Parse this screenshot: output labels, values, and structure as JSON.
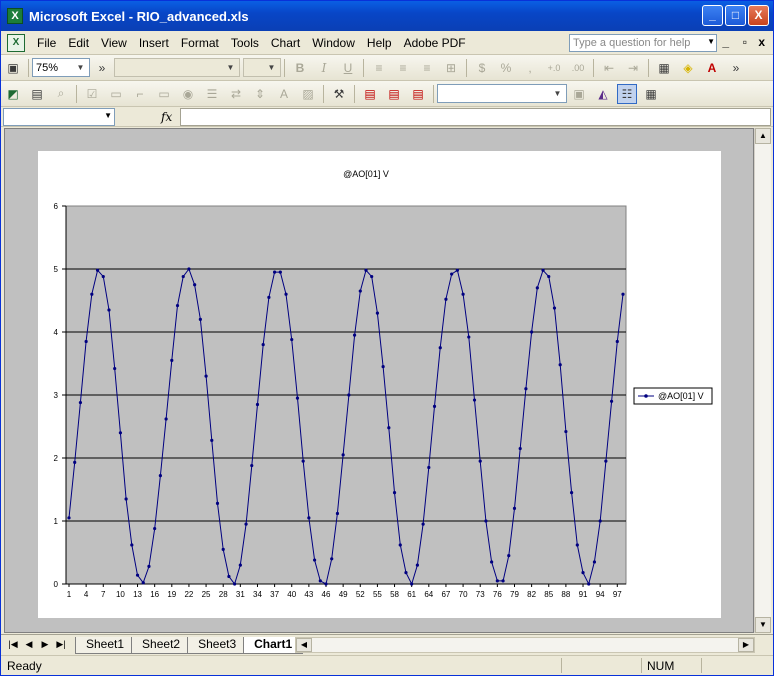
{
  "window": {
    "title": "Microsoft Excel - RIO_advanced.xls",
    "app_icon": "excel-icon",
    "minimize": "_",
    "maximize": "□",
    "close": "X"
  },
  "menu": {
    "items": [
      "File",
      "Edit",
      "View",
      "Insert",
      "Format",
      "Tools",
      "Chart",
      "Window",
      "Help",
      "Adobe PDF"
    ],
    "ask_placeholder": "Type a question for help",
    "restore": "▫",
    "close": "x"
  },
  "toolbar1": {
    "zoom": "75%",
    "bold": "B",
    "italic": "I",
    "underline": "U",
    "currency": "$",
    "percent": "%",
    "comma": ",",
    "more": "»"
  },
  "toolbar2": {
    "more": "»"
  },
  "formula": {
    "fx_label": "fx",
    "value": ""
  },
  "sheet_tabs": {
    "tabs": [
      "Sheet1",
      "Sheet2",
      "Sheet3",
      "Chart1"
    ],
    "active": "Chart1"
  },
  "status": {
    "ready": "Ready",
    "num": "NUM"
  },
  "chart_data": {
    "type": "line",
    "title": "@AO[01] V",
    "legend": [
      "@AO[01] V"
    ],
    "legend_position": "right",
    "ylim": [
      0,
      6
    ],
    "yticks": [
      0,
      1,
      2,
      3,
      4,
      5,
      6
    ],
    "grid": true,
    "xticks": [
      1,
      4,
      7,
      10,
      13,
      16,
      19,
      22,
      25,
      28,
      31,
      34,
      37,
      40,
      43,
      46,
      49,
      52,
      55,
      58,
      61,
      64,
      67,
      70,
      73,
      76,
      79,
      82,
      85,
      88,
      91,
      94,
      97
    ],
    "series": [
      {
        "name": "@AO[01] V",
        "color": "#000080",
        "x": [
          1,
          2,
          3,
          4,
          5,
          6,
          7,
          8,
          9,
          10,
          11,
          12,
          13,
          14,
          15,
          16,
          17,
          18,
          19,
          20,
          21,
          22,
          23,
          24,
          25,
          26,
          27,
          28,
          29,
          30,
          31,
          32,
          33,
          34,
          35,
          36,
          37,
          38,
          39,
          40,
          41,
          42,
          43,
          44,
          45,
          46,
          47,
          48,
          49,
          50,
          51,
          52,
          53,
          54,
          55,
          56,
          57,
          58,
          59,
          60,
          61,
          62,
          63,
          64,
          65,
          66,
          67,
          68,
          69,
          70,
          71,
          72,
          73,
          74,
          75,
          76,
          77,
          78,
          79,
          80,
          81,
          82,
          83,
          84,
          85,
          86,
          87,
          88,
          89,
          90,
          91,
          92,
          93,
          94,
          95,
          96,
          97,
          98
        ],
        "values": [
          1.05,
          1.93,
          2.88,
          3.85,
          4.6,
          4.98,
          4.88,
          4.35,
          3.42,
          2.4,
          1.35,
          0.62,
          0.14,
          0.02,
          0.28,
          0.88,
          1.72,
          2.62,
          3.55,
          4.42,
          4.88,
          5.0,
          4.75,
          4.2,
          3.3,
          2.28,
          1.28,
          0.55,
          0.12,
          0.0,
          0.3,
          0.95,
          1.88,
          2.85,
          3.8,
          4.55,
          4.95,
          4.95,
          4.6,
          3.88,
          2.95,
          1.95,
          1.05,
          0.38,
          0.05,
          0.0,
          0.4,
          1.12,
          2.05,
          3.0,
          3.95,
          4.65,
          4.98,
          4.88,
          4.3,
          3.45,
          2.48,
          1.45,
          0.62,
          0.18,
          0.0,
          0.3,
          0.95,
          1.85,
          2.82,
          3.75,
          4.52,
          4.92,
          4.98,
          4.6,
          3.92,
          2.92,
          1.95,
          1.0,
          0.35,
          0.05,
          0.05,
          0.45,
          1.2,
          2.15,
          3.1,
          4.0,
          4.7,
          4.98,
          4.88,
          4.38,
          3.48,
          2.42,
          1.45,
          0.62,
          0.18,
          0.0,
          0.35,
          1.0,
          1.95,
          2.9,
          3.85,
          4.6
        ]
      }
    ]
  }
}
